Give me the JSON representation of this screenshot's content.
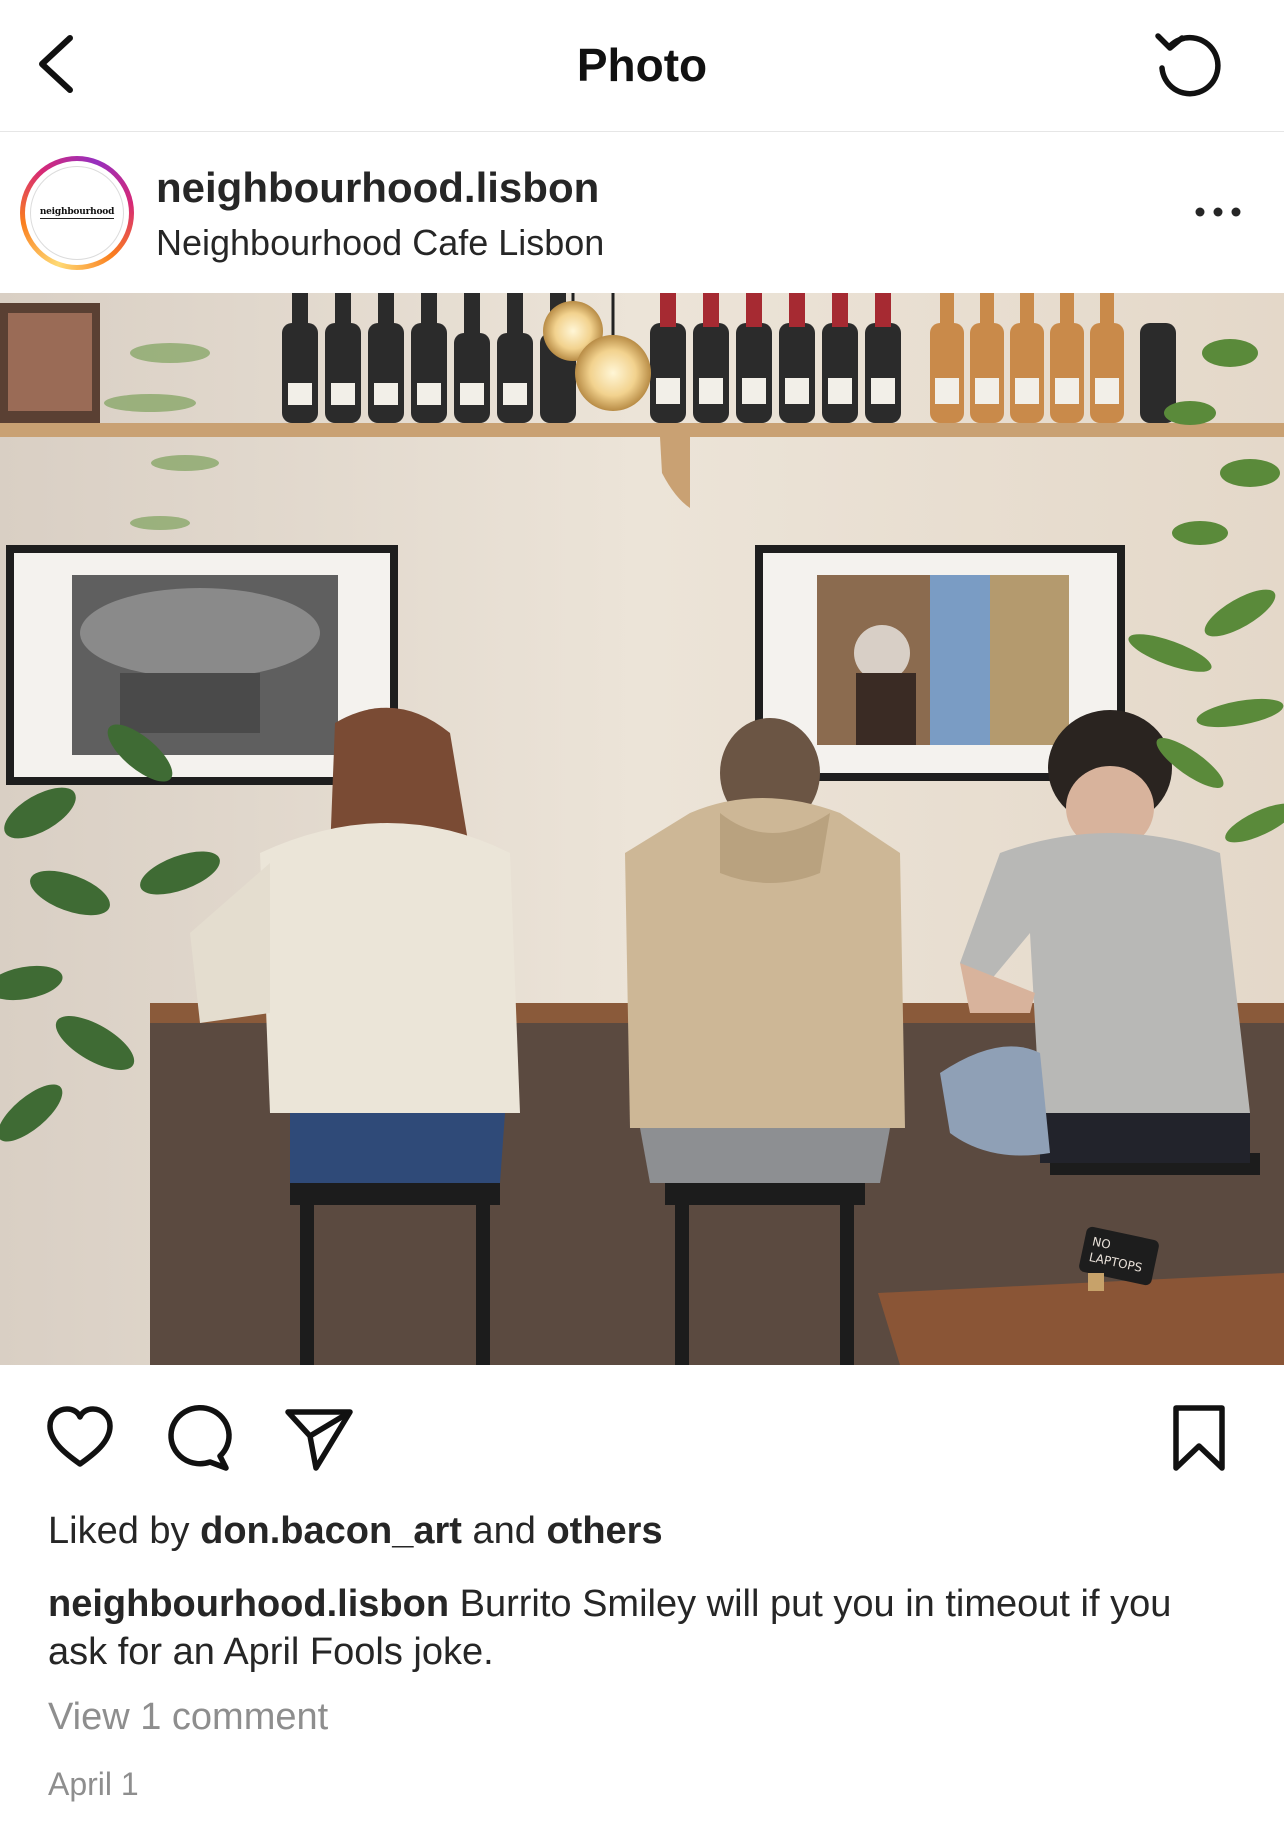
{
  "header": {
    "title": "Photo"
  },
  "post": {
    "avatar_text": "neighbourhood",
    "username": "neighbourhood.lisbon",
    "location": "Neighbourhood Cafe Lisbon",
    "image": {
      "sign_text_1": "NO",
      "sign_text_2": "LAPTOPS"
    },
    "liked_by_prefix": "Liked by",
    "liked_by_user": "don.bacon_art",
    "liked_by_middle": "and",
    "liked_by_others": "others",
    "caption_user": "neighbourhood.lisbon",
    "caption_text": "Burrito Smiley will put you in timeout if you ask for an April Fools joke.",
    "view_comments": "View 1 comment",
    "date": "April 1"
  },
  "icons": {
    "back": "chevron-left-icon",
    "refresh": "refresh-icon",
    "more": "more-horizontal-icon",
    "like": "heart-icon",
    "comment": "comment-icon",
    "share": "send-icon",
    "save": "bookmark-icon"
  }
}
